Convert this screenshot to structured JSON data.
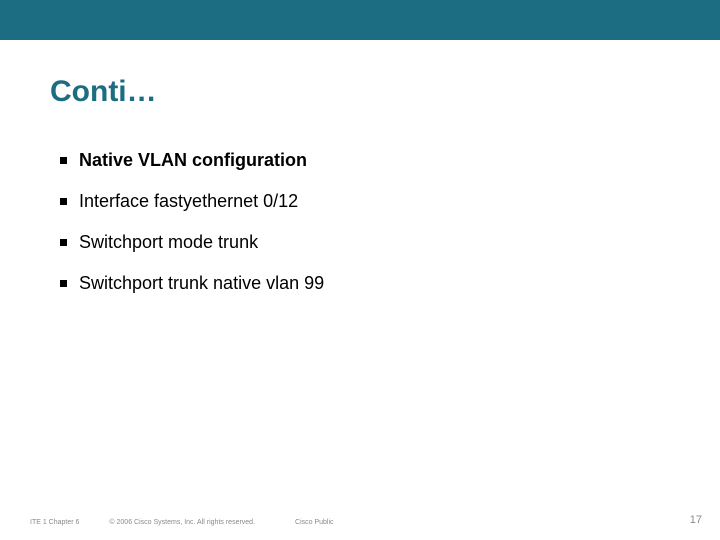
{
  "slide": {
    "title": "Conti…",
    "bullets": [
      {
        "text": "Native VLAN configuration",
        "bold": true
      },
      {
        "text": "Interface fastyethernet 0/12",
        "bold": false
      },
      {
        "text": "Switchport mode trunk",
        "bold": false
      },
      {
        "text": "Switchport trunk native vlan 99",
        "bold": false
      }
    ],
    "footer": {
      "left": "ITE 1 Chapter 6",
      "copyright": "© 2006 Cisco Systems, Inc. All rights reserved.",
      "public": "Cisco Public",
      "page": "17"
    },
    "colors": {
      "accent": "#1d6d82"
    }
  }
}
